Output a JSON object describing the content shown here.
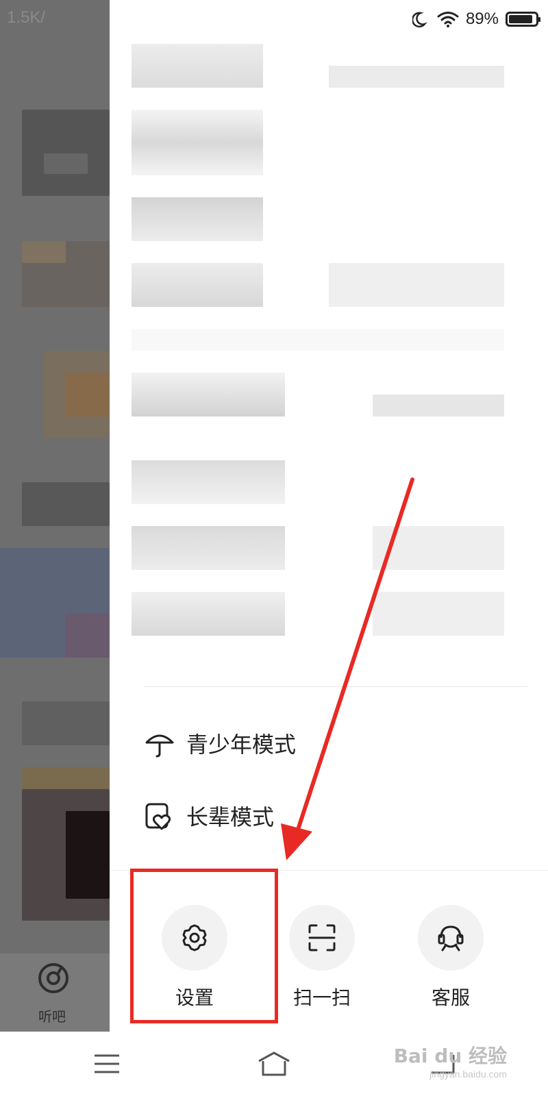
{
  "left_background": {
    "status_text": "1.5K/",
    "nav_label": "听吧"
  },
  "status_bar": {
    "battery_text": "89%",
    "battery_level": 0.89
  },
  "drawer": {
    "modes": [
      {
        "label": "青少年模式",
        "icon": "umbrella-icon"
      },
      {
        "label": "长辈模式",
        "icon": "heart-tag-icon"
      }
    ],
    "actions": [
      {
        "label": "设置",
        "icon": "gear-icon"
      },
      {
        "label": "扫一扫",
        "icon": "scan-icon"
      },
      {
        "label": "客服",
        "icon": "headset-icon"
      }
    ]
  },
  "annotation": {
    "highlight_color": "#e82a25"
  },
  "watermark": {
    "text": "Bai du 经验",
    "sub": "jingyan.baidu.com"
  }
}
